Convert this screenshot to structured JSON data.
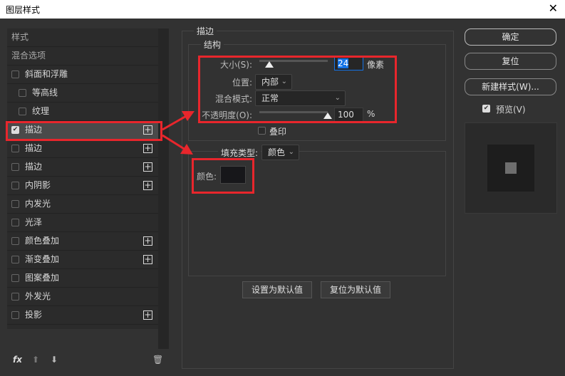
{
  "window": {
    "title": "图层样式",
    "close": "✕"
  },
  "sidebar": {
    "items": [
      {
        "label": "样式",
        "checkbox": false,
        "plus": false
      },
      {
        "label": "混合选项",
        "checkbox": false,
        "plus": false
      },
      {
        "label": "斜面和浮雕",
        "checkbox": true,
        "checked": false,
        "plus": false
      },
      {
        "label": "等高线",
        "checkbox": true,
        "checked": false,
        "plus": false,
        "indent": true
      },
      {
        "label": "纹理",
        "checkbox": true,
        "checked": false,
        "plus": false,
        "indent": true
      },
      {
        "label": "描边",
        "checkbox": true,
        "checked": true,
        "plus": true,
        "selected": true
      },
      {
        "label": "描边",
        "checkbox": true,
        "checked": false,
        "plus": true
      },
      {
        "label": "描边",
        "checkbox": true,
        "checked": false,
        "plus": true
      },
      {
        "label": "内阴影",
        "checkbox": true,
        "checked": false,
        "plus": true
      },
      {
        "label": "内发光",
        "checkbox": true,
        "checked": false,
        "plus": false
      },
      {
        "label": "光泽",
        "checkbox": true,
        "checked": false,
        "plus": false
      },
      {
        "label": "颜色叠加",
        "checkbox": true,
        "checked": false,
        "plus": true
      },
      {
        "label": "渐变叠加",
        "checkbox": true,
        "checked": false,
        "plus": true
      },
      {
        "label": "图案叠加",
        "checkbox": true,
        "checked": false,
        "plus": false
      },
      {
        "label": "外发光",
        "checkbox": true,
        "checked": false,
        "plus": false
      },
      {
        "label": "投影",
        "checkbox": true,
        "checked": false,
        "plus": true
      }
    ],
    "toolbar": {
      "fx": "fx",
      "up": "⬆",
      "down": "⬇",
      "trash": "🗑"
    }
  },
  "stroke": {
    "title": "描边",
    "structure": "结构",
    "size_label": "大小(S):",
    "size_value": "24",
    "size_unit": "像素",
    "size_fraction": 0.15,
    "position_label": "位置:",
    "position_value": "内部",
    "blend_label": "混合模式:",
    "blend_value": "正常",
    "opacity_label": "不透明度(O):",
    "opacity_value": "100",
    "opacity_unit": "%",
    "opacity_fraction": 1.0,
    "overprint_label": "叠印",
    "fill_type_label": "填充类型:",
    "fill_type_value": "颜色",
    "color_label": "颜色:",
    "color_swatch": "#17171a",
    "set_default": "设置为默认值",
    "reset_default": "复位为默认值"
  },
  "buttons": {
    "ok": "确定",
    "reset": "复位",
    "new_style": "新建样式(W)...",
    "preview": "预览(V)"
  },
  "colors": {
    "highlight": "#e8262c",
    "accent": "#1473e6"
  }
}
